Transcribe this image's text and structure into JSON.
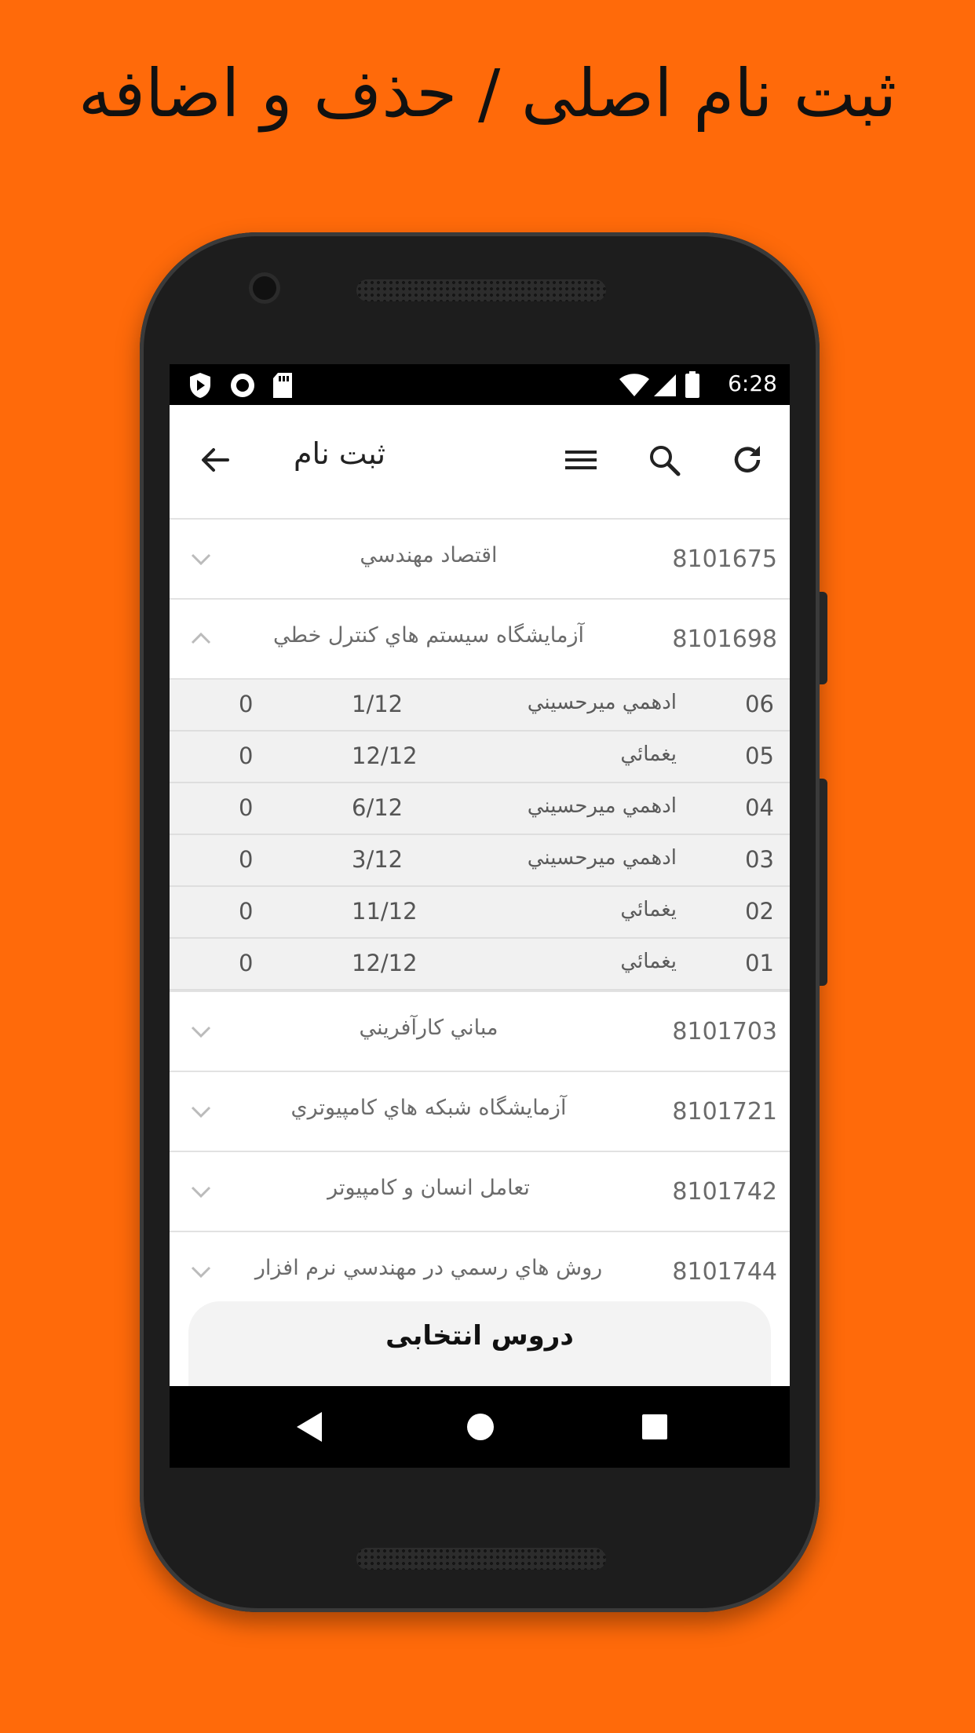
{
  "headline": "ثبت نام اصلی / حذف و اضافه",
  "statusbar": {
    "time": "6:28",
    "left_icons": [
      "shield-play-icon",
      "record-icon",
      "sd-card-icon"
    ],
    "right_icons": [
      "wifi-icon",
      "signal-icon",
      "battery-icon"
    ]
  },
  "appbar": {
    "title": "ثبت نام",
    "back_icon": "arrow-back-icon",
    "menu_icon": "menu-icon",
    "search_icon": "search-icon",
    "refresh_icon": "refresh-icon"
  },
  "courses": [
    {
      "code": "8101675",
      "name": "اقتصاد مهندسي",
      "expanded": false
    },
    {
      "code": "8101698",
      "name": "آزمايشگاه سيستم هاي كنترل خطي",
      "expanded": true,
      "sections": [
        {
          "num": "06",
          "prof": "ادهمي ميرحسيني",
          "cap": "1/12",
          "zero": "0"
        },
        {
          "num": "05",
          "prof": "يغمائي",
          "cap": "12/12",
          "zero": "0"
        },
        {
          "num": "04",
          "prof": "ادهمي ميرحسيني",
          "cap": "6/12",
          "zero": "0"
        },
        {
          "num": "03",
          "prof": "ادهمي ميرحسيني",
          "cap": "3/12",
          "zero": "0"
        },
        {
          "num": "02",
          "prof": "يغمائي",
          "cap": "11/12",
          "zero": "0"
        },
        {
          "num": "01",
          "prof": "يغمائي",
          "cap": "12/12",
          "zero": "0"
        }
      ]
    },
    {
      "code": "8101703",
      "name": "مباني كارآفريني",
      "expanded": false
    },
    {
      "code": "8101721",
      "name": "آزمايشگاه شبكه هاي كامپيوتري",
      "expanded": false
    },
    {
      "code": "8101742",
      "name": "تعامل انسان و كامپيوتر",
      "expanded": false
    },
    {
      "code": "8101744",
      "name": "روش هاي رسمي در مهندسي نرم افزار",
      "expanded": false
    }
  ],
  "selected_courses_button": "دروس انتخابی",
  "navbar": {
    "back": "nav-back-icon",
    "home": "nav-home-icon",
    "recents": "nav-recents-icon"
  },
  "colors": {
    "background": "#FF6A0A",
    "phone": "#1d1d1d"
  }
}
